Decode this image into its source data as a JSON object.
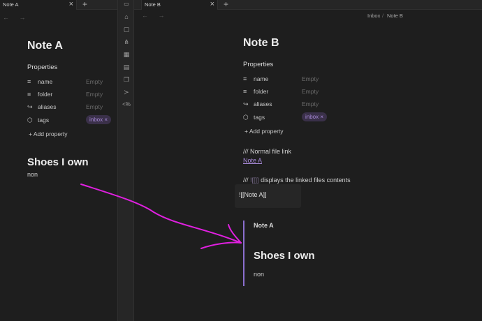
{
  "left_pane": {
    "tab": {
      "label": "Note A",
      "close": "×"
    },
    "new_tab": "+",
    "nav": "← →",
    "title": "Note A",
    "properties_heading": "Properties",
    "properties": [
      {
        "icon": "text-icon",
        "key": "name",
        "value": "Empty"
      },
      {
        "icon": "text-icon",
        "key": "folder",
        "value": "Empty"
      },
      {
        "icon": "forward-arrow-icon",
        "key": "aliases",
        "value": "Empty"
      },
      {
        "icon": "tag-icon",
        "key": "tags",
        "value": "inbox ×"
      }
    ],
    "add_property": "+ Add property",
    "heading": "Shoes I own",
    "body": "non"
  },
  "ribbon": {
    "icons": [
      "home-icon",
      "file-icon",
      "graph-icon",
      "grid-icon",
      "calendar-icon",
      "copy-icon",
      "terminal-icon",
      "code-icon"
    ]
  },
  "right_pane": {
    "tab": {
      "label": "Note B",
      "close": "×"
    },
    "new_tab": "+",
    "nav": "← →",
    "breadcrumb": {
      "folder": "Inbox",
      "sep": "/",
      "note": "Note B"
    },
    "title": "Note B",
    "properties_heading": "Properties",
    "properties": [
      {
        "icon": "text-icon",
        "key": "name",
        "value": "Empty"
      },
      {
        "icon": "text-icon",
        "key": "folder",
        "value": "Empty"
      },
      {
        "icon": "forward-arrow-icon",
        "key": "aliases",
        "value": "Empty"
      },
      {
        "icon": "tag-icon",
        "key": "tags",
        "value": "inbox ×"
      }
    ],
    "add_property": "+ Add property",
    "comment1": "/// Normal file link",
    "link": "Note A",
    "comment2_prefix": "///",
    "comment2_code": "![[]]",
    "comment2_suffix": "displays the linked files contents",
    "code": "![[Note A]]",
    "embed": {
      "title": "Note A",
      "heading": "Shoes I own",
      "body": "non"
    }
  },
  "colors": {
    "accent": "#8b6fcf",
    "annotation_arrow": "#e020e0"
  }
}
